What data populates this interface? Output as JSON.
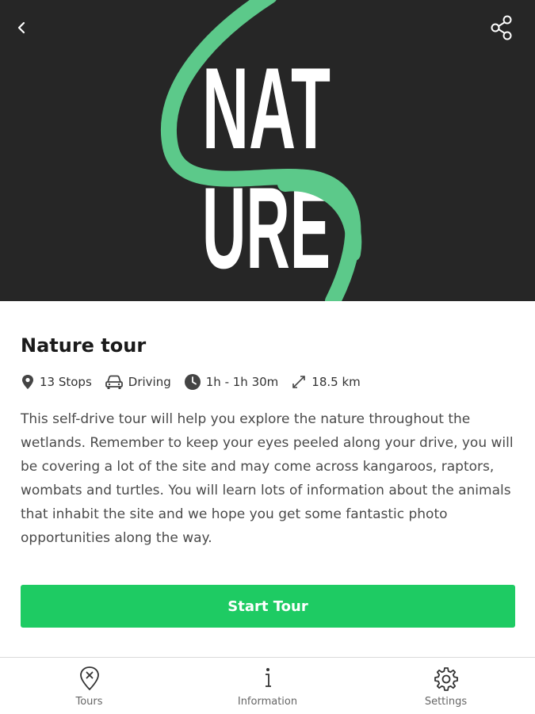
{
  "hero": {
    "logo_line1": "NAT",
    "logo_line2": "URE",
    "background_color": "#262626",
    "accent_color": "#5cc98a",
    "back_icon": "chevron-left-icon",
    "share_icon": "share-icon"
  },
  "tour": {
    "title": "Nature tour",
    "meta": {
      "stops": "13 Stops",
      "mode": "Driving",
      "duration": "1h - 1h 30m",
      "distance": "18.5 km"
    },
    "description": "This self-drive tour will help you explore the nature throughout the wetlands. Remember to keep your eyes peeled along your drive, you will be covering a lot of the site and may come across kangaroos, raptors, wombats and turtles. You will learn lots of information about the animals that inhabit the site and we hope you get some fantastic photo opportunities along the way.",
    "start_label": "Start Tour",
    "button_color": "#1ecb63"
  },
  "bottom_nav": {
    "items": [
      {
        "label": "Tours",
        "icon": "map-pin-x-icon"
      },
      {
        "label": "Information",
        "icon": "info-icon"
      },
      {
        "label": "Settings",
        "icon": "gear-icon"
      }
    ]
  }
}
